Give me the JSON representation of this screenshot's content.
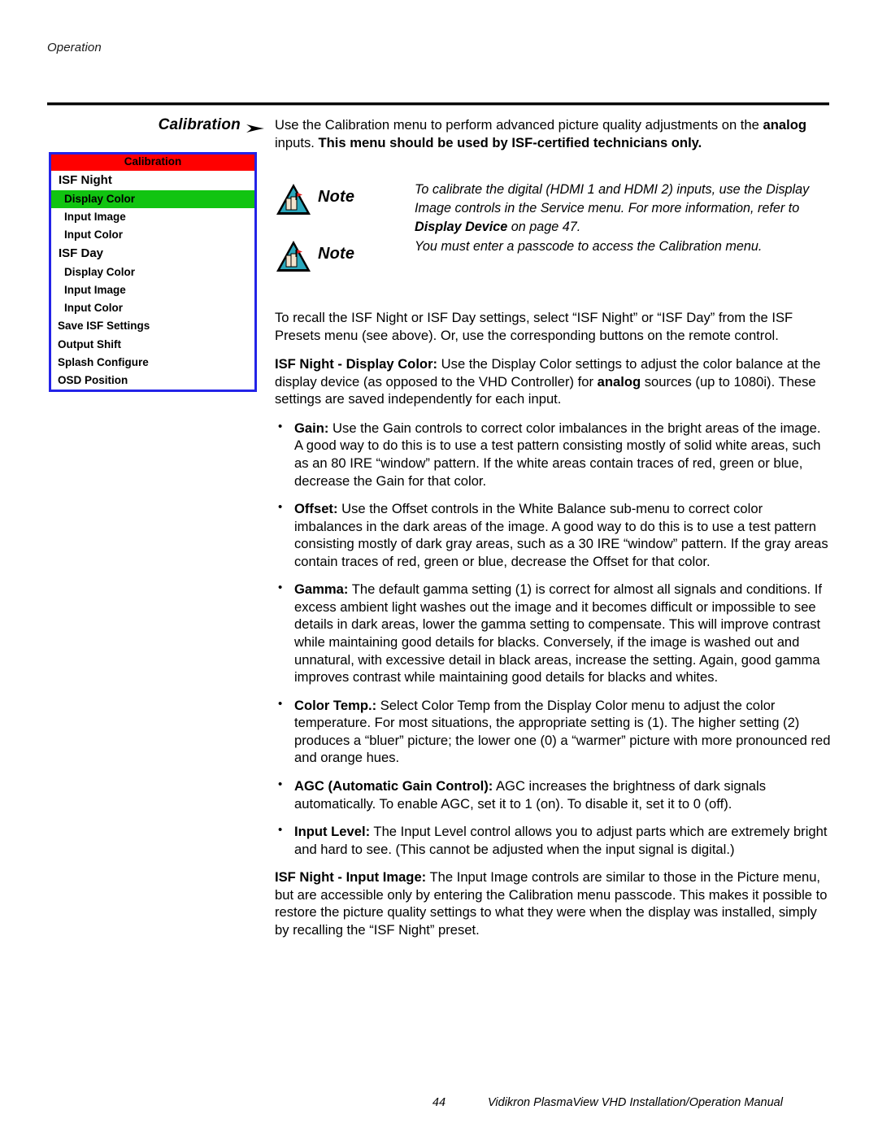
{
  "page": {
    "running_head": "Operation",
    "section_label": "Calibration",
    "arrow_icon": "right-arrow-icon"
  },
  "osd_menu": {
    "title": "Calibration",
    "items": [
      {
        "label": "ISF Night",
        "level": 1,
        "selected": false
      },
      {
        "label": "Display Color",
        "level": 2,
        "selected": true
      },
      {
        "label": "Input Image",
        "level": 2,
        "selected": false
      },
      {
        "label": "Input Color",
        "level": 2,
        "selected": false
      },
      {
        "label": "ISF Day",
        "level": 1,
        "selected": false
      },
      {
        "label": "Display Color",
        "level": 2,
        "selected": false
      },
      {
        "label": "Input Image",
        "level": 2,
        "selected": false
      },
      {
        "label": "Input Color",
        "level": 2,
        "selected": false
      },
      {
        "label": "Save ISF Settings",
        "level": 0,
        "selected": false
      },
      {
        "label": "Output Shift",
        "level": 0,
        "selected": false
      },
      {
        "label": "Splash Configure",
        "level": 0,
        "selected": false
      },
      {
        "label": "OSD Position",
        "level": 0,
        "selected": false
      }
    ],
    "colors": {
      "title_bg": "#ff0000",
      "border": "#2323e8",
      "selected_bg": "#11c411",
      "body_bg": "#ffffff"
    }
  },
  "intro": {
    "part1": "Use the Calibration menu to perform advanced picture quality adjustments on the ",
    "bold1": "analog",
    "part2": " inputs. ",
    "bold2": "This menu should be used by ISF-certified technicians only."
  },
  "notes": [
    {
      "label": "Note",
      "icon": "note-warning-icon",
      "part1": "To calibrate the digital (HDMI 1 and HDMI 2) inputs, use the Display Image controls in the Service menu. For more information, refer to ",
      "bold": "Display Device",
      "part2": " on page 47."
    },
    {
      "label": "Note",
      "icon": "note-warning-icon",
      "part1": "You must enter a passcode to access the Calibration menu.",
      "bold": "",
      "part2": ""
    }
  ],
  "body": {
    "recall_paragraph": "To recall the ISF Night or ISF Day settings, select “ISF Night” or “ISF Day” from the ISF Presets menu (see above). Or, use the corresponding buttons on the remote control.",
    "display_color": {
      "heading": "ISF Night - Display Color:",
      "part1": " Use the Display Color settings to adjust the color balance at the display device (as opposed to the VHD Controller) for ",
      "bold1": "analog",
      "part2": " sources (up to 1080i). These settings are saved independently for each input."
    },
    "input_image": {
      "heading": "ISF Night - Input Image:",
      "text": " The Input Image controls are similar to those in the Picture menu, but are accessible only by entering the Calibration menu passcode. This makes it possible to restore the picture quality settings to what they were when the display was installed, simply by recalling the “ISF Night” preset."
    }
  },
  "bullets": [
    {
      "term": "Gain:",
      "text": " Use the Gain controls to correct color imbalances in the bright areas of the image. A good way to do this is to use a test pattern consisting mostly of solid white areas, such as an 80 IRE “window” pattern. If the white areas contain traces of red, green or blue, decrease the Gain for that color."
    },
    {
      "term": "Offset:",
      "text": " Use the Offset controls in the White Balance sub-menu to correct color imbalances in the dark areas of the image. A good way to do this is to use a test pattern consisting mostly of dark gray areas, such as a 30 IRE “window” pattern. If the gray areas contain traces of red, green or blue, decrease the Offset for that color."
    },
    {
      "term": "Gamma:",
      "text": " The default gamma setting (1) is correct for almost all signals and conditions. If excess ambient light washes out the image and it becomes difficult or impossible to see details in dark areas, lower the gamma setting to compensate. This will improve contrast while maintaining good details for blacks. Conversely, if the image is washed out and unnatural, with excessive detail in black areas, increase the setting. Again, good gamma improves contrast while maintaining good details for blacks and whites."
    },
    {
      "term": "Color Temp.:",
      "text": " Select Color Temp from the Display Color menu to adjust the color temperature. For most situations, the appropriate setting is (1). The higher setting (2) produces a “bluer” picture; the lower one (0) a “warmer” picture with more pronounced red and orange hues."
    },
    {
      "term": "AGC (Automatic Gain Control):",
      "text": " AGC increases the brightness of dark signals automatically. To enable AGC, set it to 1 (on). To disable it, set it to 0 (off)."
    },
    {
      "term": "Input Level:",
      "text": " The Input Level control allows you to adjust parts which are extremely bright and hard to see. (This cannot be adjusted when the input signal is digital.)"
    }
  ],
  "footer": {
    "page_number": "44",
    "manual_title": "Vidikron PlasmaView VHD Installation/Operation Manual"
  }
}
